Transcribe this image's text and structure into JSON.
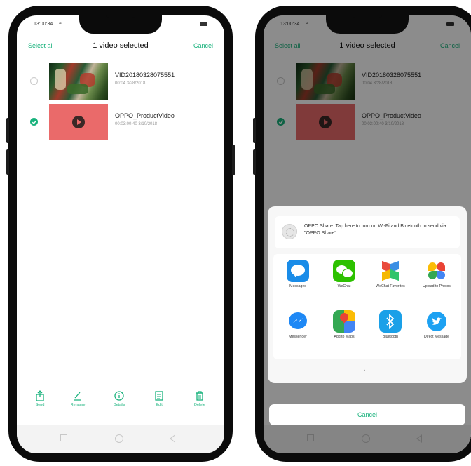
{
  "status": {
    "time": "13:00:34"
  },
  "header": {
    "select_all": "Select all",
    "title": "1 video selected",
    "cancel": "Cancel"
  },
  "videos": [
    {
      "name": "VID20180328075551",
      "meta": "00:04 3/28/2018",
      "checked": false
    },
    {
      "name": "OPPO_ProductVideo",
      "meta": "00:03:00:40 3/10/2018",
      "checked": true
    }
  ],
  "toolbar": {
    "send": "Send",
    "rename": "Rename",
    "details": "Details",
    "edit": "Edit",
    "delete": "Delete"
  },
  "share": {
    "oppo_text": "OPPO Share. Tap here to turn on Wi-Fi and Bluetooth to send via \"OPPO Share\".",
    "apps": [
      "Messages",
      "WeChat",
      "WeChat Favorites",
      "Upload to Photos",
      "Messenger",
      "Add to Maps",
      "Bluetooth",
      "Direct Message"
    ],
    "cancel": "Cancel"
  },
  "colors": {
    "accent": "#18b27c",
    "thumb_red": "#ea6a6a"
  },
  "icons": [
    "send-icon",
    "rename-icon",
    "details-icon",
    "edit-icon",
    "delete-icon",
    "checkmark-icon",
    "play-icon",
    "wifi-icon",
    "battery-icon"
  ]
}
